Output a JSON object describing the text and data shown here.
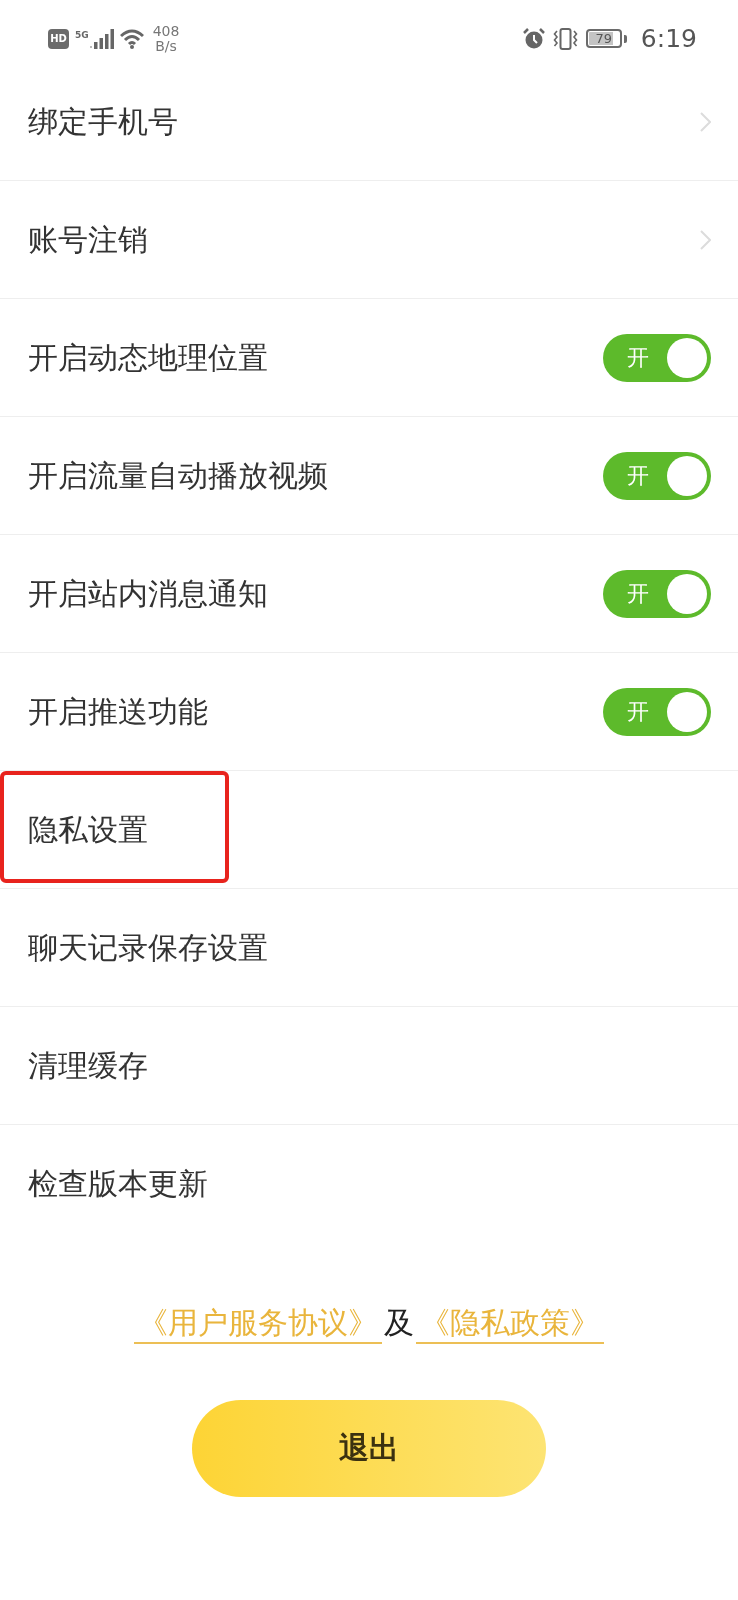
{
  "status_bar": {
    "hd_badge": "HD",
    "network_type": "5G",
    "speed_value": "408",
    "speed_unit": "B/s",
    "battery": "79",
    "time": "6:19"
  },
  "rows": [
    {
      "kind": "link",
      "label": "绑定手机号",
      "highlighted": false
    },
    {
      "kind": "link",
      "label": "账号注销",
      "highlighted": false
    },
    {
      "kind": "toggle",
      "label": "开启动态地理位置",
      "on": true,
      "switch_text": "开",
      "highlighted": false
    },
    {
      "kind": "toggle",
      "label": "开启流量自动播放视频",
      "on": true,
      "switch_text": "开",
      "highlighted": false
    },
    {
      "kind": "toggle",
      "label": "开启站内消息通知",
      "on": true,
      "switch_text": "开",
      "highlighted": false
    },
    {
      "kind": "toggle",
      "label": "开启推送功能",
      "on": true,
      "switch_text": "开",
      "highlighted": false
    },
    {
      "kind": "plain",
      "label": "隐私设置",
      "highlighted": true
    },
    {
      "kind": "plain",
      "label": "聊天记录保存设置",
      "highlighted": false
    },
    {
      "kind": "plain",
      "label": "清理缓存",
      "highlighted": false
    },
    {
      "kind": "plain",
      "label": "检查版本更新",
      "highlighted": false
    }
  ],
  "agreement": {
    "links": [
      "《用户服务协议》",
      "《隐私政策》"
    ],
    "joiner": "及"
  },
  "logout_button": "退出"
}
